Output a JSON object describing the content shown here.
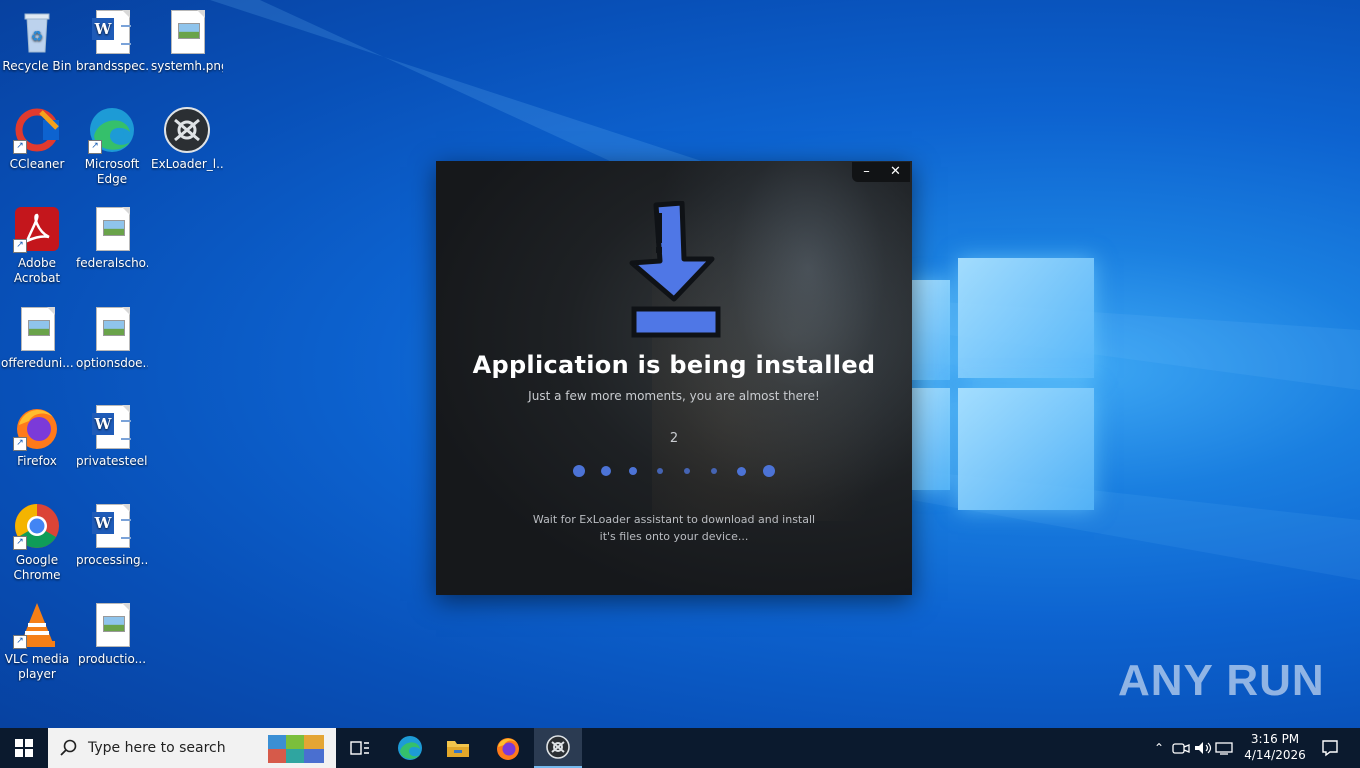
{
  "desktop": {
    "icons": [
      {
        "label": "Recycle Bin"
      },
      {
        "label": "brandsspec..."
      },
      {
        "label": "systemh.png"
      },
      {
        "label": "CCleaner"
      },
      {
        "label": "Microsoft Edge"
      },
      {
        "label": "ExLoader_l..."
      },
      {
        "label": "Adobe Acrobat"
      },
      {
        "label": "federalscho..."
      },
      {
        "label": "offereduni..."
      },
      {
        "label": "optionsdoe..."
      },
      {
        "label": "Firefox"
      },
      {
        "label": "privatesteel..."
      },
      {
        "label": "Google Chrome"
      },
      {
        "label": "processing..."
      },
      {
        "label": "VLC media player"
      },
      {
        "label": "productio..."
      }
    ],
    "watermark": "ANY RUN"
  },
  "installer": {
    "minimize_glyph": "–",
    "close_glyph": "✕",
    "title": "Application is being installed",
    "subtitle": "Just a few more moments, you are almost there!",
    "counter": "2",
    "note_line1": "Wait for ExLoader assistant to download and install",
    "note_line2": "it's files onto your device...",
    "accent": "#4c73d6"
  },
  "taskbar": {
    "search_placeholder": "Type here to search",
    "apps": [
      "task-view",
      "edge",
      "file-explorer",
      "firefox",
      "exloader"
    ],
    "clock_time": "3:16 PM",
    "clock_date": "4/14/2026"
  }
}
